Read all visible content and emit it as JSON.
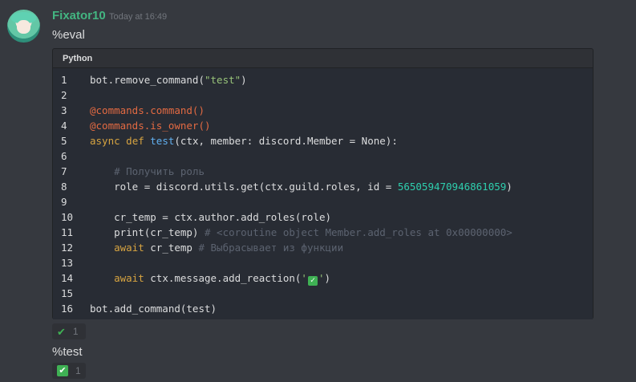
{
  "message1": {
    "author": "Fixator10",
    "timestamp": "Today at 16:49",
    "text": "%eval",
    "code_language": "Python",
    "code_lines": [
      {
        "n": "1",
        "tokens": [
          {
            "t": "bot.remove_command(",
            "c": ""
          },
          {
            "t": "\"test\"",
            "c": "str"
          },
          {
            "t": ")",
            "c": ""
          }
        ]
      },
      {
        "n": "2",
        "tokens": []
      },
      {
        "n": "3",
        "tokens": [
          {
            "t": "@commands.command()",
            "c": "deco"
          }
        ]
      },
      {
        "n": "4",
        "tokens": [
          {
            "t": "@commands.is_owner()",
            "c": "deco"
          }
        ]
      },
      {
        "n": "5",
        "tokens": [
          {
            "t": "async",
            "c": "kw2"
          },
          {
            "t": " ",
            "c": ""
          },
          {
            "t": "def",
            "c": "kw2"
          },
          {
            "t": " ",
            "c": ""
          },
          {
            "t": "test",
            "c": "fn"
          },
          {
            "t": "(ctx, member: discord.Member = None):",
            "c": ""
          }
        ]
      },
      {
        "n": "6",
        "tokens": []
      },
      {
        "n": "7",
        "tokens": [
          {
            "t": "    ",
            "c": ""
          },
          {
            "t": "# Получить роль",
            "c": "com"
          }
        ]
      },
      {
        "n": "8",
        "tokens": [
          {
            "t": "    role = discord.utils.get(ctx.guild.roles, id = ",
            "c": ""
          },
          {
            "t": "565059470946861059",
            "c": "num"
          },
          {
            "t": ")",
            "c": ""
          }
        ]
      },
      {
        "n": "9",
        "tokens": []
      },
      {
        "n": "10",
        "tokens": [
          {
            "t": "    cr_temp = ctx.author.add_roles(role)",
            "c": ""
          }
        ]
      },
      {
        "n": "11",
        "tokens": [
          {
            "t": "    print(cr_temp) ",
            "c": ""
          },
          {
            "t": "# <coroutine object Member.add_roles at 0x00000000>",
            "c": "com"
          }
        ]
      },
      {
        "n": "12",
        "tokens": [
          {
            "t": "    ",
            "c": ""
          },
          {
            "t": "await",
            "c": "kw2"
          },
          {
            "t": " cr_temp ",
            "c": ""
          },
          {
            "t": "# Выбрасывает из функции",
            "c": "com"
          }
        ]
      },
      {
        "n": "13",
        "tokens": []
      },
      {
        "n": "14",
        "tokens": [
          {
            "t": "    ",
            "c": ""
          },
          {
            "t": "await",
            "c": "kw2"
          },
          {
            "t": " ctx.message.add_reaction(",
            "c": ""
          },
          {
            "t": "'",
            "c": "str"
          },
          {
            "t": "✓",
            "c": "emoji"
          },
          {
            "t": "'",
            "c": "str"
          },
          {
            "t": ")",
            "c": ""
          }
        ]
      },
      {
        "n": "15",
        "tokens": []
      },
      {
        "n": "16",
        "tokens": [
          {
            "t": "bot.add_command(test)",
            "c": ""
          }
        ]
      }
    ],
    "reaction": {
      "icon": "check-mark-icon",
      "count": "1"
    }
  },
  "message2": {
    "text": "%test",
    "reaction": {
      "icon": "white-check-mark-icon",
      "count": "1"
    }
  },
  "colors": {
    "background": "#36393f",
    "username": "#43b581",
    "code_background": "#282c34",
    "decorator": "#e36a42",
    "keyword": "#d7a441",
    "function": "#61afef",
    "string": "#98c379",
    "number": "#2ecfae",
    "comment": "#5c6370"
  }
}
